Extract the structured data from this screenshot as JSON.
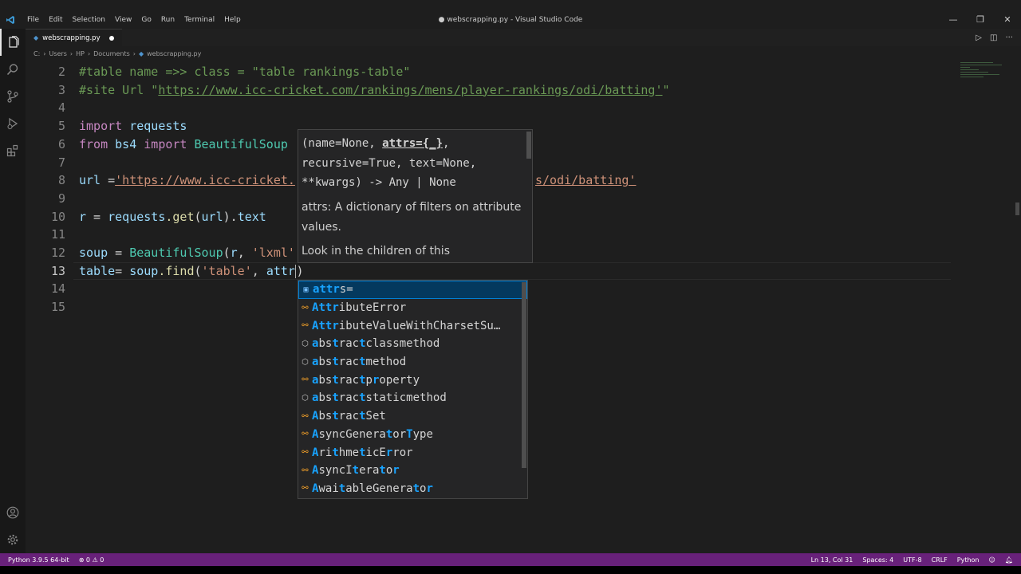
{
  "window": {
    "title": "● webscrapping.py - Visual Studio Code",
    "menu": [
      "File",
      "Edit",
      "Selection",
      "View",
      "Go",
      "Run",
      "Terminal",
      "Help"
    ],
    "controls": [
      "—",
      "❐",
      "✕"
    ]
  },
  "tab": {
    "icon": "python-file-icon",
    "label": "webscrapping.py"
  },
  "breadcrumb": [
    "C:",
    "Users",
    "HP",
    "Documents",
    "webscrapping.py"
  ],
  "editor": {
    "line_numbers": [
      "2",
      "3",
      "4",
      "5",
      "6",
      "7",
      "8",
      "9",
      "10",
      "11",
      "12",
      "13",
      "14",
      "15"
    ],
    "current_line": "13"
  },
  "code": {
    "l2": "#table name =>> class = \"table rankings-table\"",
    "l3_prefix": "#site Url \"",
    "l3_url": "https://www.icc-cricket.com/rankings/mens/player-rankings/odi/batting'",
    "l3_suffix": "\"",
    "l5_kw": "import",
    "l5_rest": " requests",
    "l6_kw1": "from",
    "l6_mod": " bs4 ",
    "l6_kw2": "import",
    "l6_cls": " BeautifulSoup",
    "l8_var": "url",
    "l8_op": " =",
    "l8_str1": "'https://www.icc-cricket.",
    "l8_str2": "s/odi/batting'",
    "l10_var": "r",
    "l10_op": " = ",
    "l10_mod": "requests",
    "l10_fn": ".get",
    "l10_a": "(",
    "l10_arg": "url",
    "l10_b": ").",
    "l10_attr": "text",
    "l12_var": "soup",
    "l12_op": " = ",
    "l12_cls": "BeautifulSoup",
    "l12_a": "(",
    "l12_arg": "r",
    "l12_b": ", ",
    "l12_str": "'lxml'",
    "l13_var": "table",
    "l13_op": "= ",
    "l13_obj": "soup",
    "l13_fn": ".find",
    "l13_a": "(",
    "l13_str": "'table'",
    "l13_b": ", ",
    "l13_typed": "attr",
    "l13_c": ")"
  },
  "signature": {
    "line1a": "(name=None, ",
    "line1b": "attrs={_}",
    "line1c": ",",
    "line2": "recursive=True, text=None,",
    "line3": "**kwargs) -> Any | None",
    "doc1": "attrs: A dictionary of filters on attribute values.",
    "doc2": "Look in the children of this"
  },
  "suggestions": [
    {
      "kind": "variable",
      "icon": "variable-icon",
      "label": "attrs="
    },
    {
      "kind": "class",
      "icon": "class-icon",
      "label": "AttributeError"
    },
    {
      "kind": "class",
      "icon": "class-icon",
      "label": "AttributeValueWithCharsetSu…"
    },
    {
      "kind": "module",
      "icon": "module-icon",
      "label": "abstractclassmethod"
    },
    {
      "kind": "module",
      "icon": "module-icon",
      "label": "abstractmethod"
    },
    {
      "kind": "class",
      "icon": "class-icon",
      "label": "abstractproperty"
    },
    {
      "kind": "module",
      "icon": "module-icon",
      "label": "abstractstaticmethod"
    },
    {
      "kind": "class",
      "icon": "class-icon",
      "label": "AbstractSet"
    },
    {
      "kind": "class",
      "icon": "class-icon",
      "label": "AsyncGeneratorType"
    },
    {
      "kind": "class",
      "icon": "class-icon",
      "label": "ArithmeticError"
    },
    {
      "kind": "class",
      "icon": "class-icon",
      "label": "AsyncIterator"
    },
    {
      "kind": "class",
      "icon": "class-icon",
      "label": "AwaitableGenerator"
    }
  ],
  "status": {
    "interpreter": "Python 3.9.5 64-bit",
    "problems": "⊗ 0 ⚠ 0",
    "position": "Ln 13, Col 31",
    "spaces": "Spaces: 4",
    "encoding": "UTF-8",
    "eol": "CRLF",
    "language": "Python"
  },
  "colors": {
    "status_bar": "#68217a",
    "editor_bg": "#1e1e1e",
    "selection": "#04395e",
    "highlight": "#18a3ff"
  }
}
